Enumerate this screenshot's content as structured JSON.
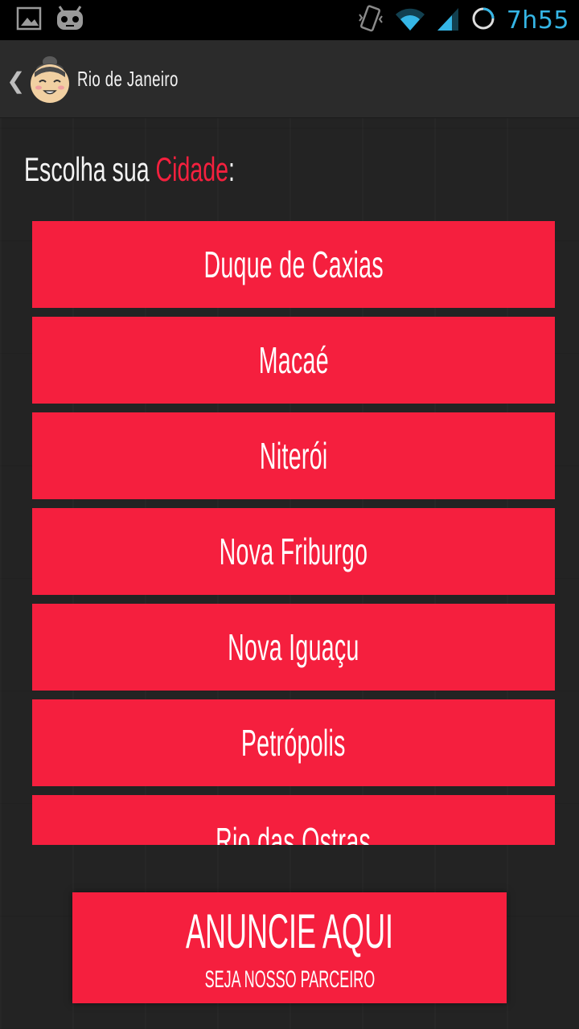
{
  "status_bar": {
    "time": "7h55",
    "left_icons": [
      "gallery-notification-icon",
      "android-mascot-notification-icon"
    ],
    "right_icons": [
      "vibrate-icon",
      "wifi-icon",
      "cell-signal-icon",
      "sync-progress-icon"
    ],
    "clock_color": "#35b6e6"
  },
  "action_bar": {
    "title": "Rio de Janeiro",
    "up_icon": "chevron-left-icon",
    "app_icon": "sumo-face-logo"
  },
  "main": {
    "headline_prefix": "Escolha sua ",
    "headline_accent": "Cidade",
    "headline_suffix": ":",
    "accent_color": "#f5203e",
    "cities": [
      {
        "label": "Duque de Caxias"
      },
      {
        "label": "Macaé"
      },
      {
        "label": "Niterói"
      },
      {
        "label": "Nova Friburgo"
      },
      {
        "label": "Nova Iguaçu"
      },
      {
        "label": "Petrópolis"
      },
      {
        "label": "Rio das Ostras"
      }
    ]
  },
  "ad_banner": {
    "title": "ANUNCIE AQUI",
    "subtitle": "SEJA NOSSO PARCEIRO"
  },
  "colors": {
    "button_red": "#f51f3e",
    "background": "#232323",
    "action_bar": "#2b2b2b"
  }
}
